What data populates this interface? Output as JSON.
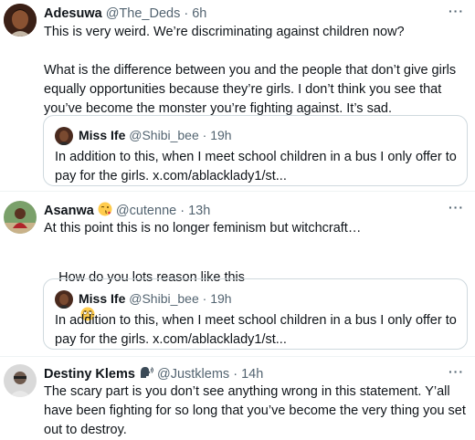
{
  "tweets": [
    {
      "name": "Adesuwa",
      "handle": "@The_Deds",
      "time": "6h",
      "text": "This is very weird. We’re discriminating against children now?\n\nWhat is the difference between you and the people that don’t give girls equally opportunities because they’re girls. I don’t think you see that you’ve become the monster you’re fighting against. It’s sad.",
      "quote": {
        "name": "Miss Ife",
        "handle": "@Shibi_bee",
        "time": "19h",
        "text": "In addition to this, when I meet school children in a bus I only offer to pay for the girls. x.com/ablacklady1/st..."
      }
    },
    {
      "name": "Asanwa",
      "name_emoji": "face-blowing-kiss",
      "handle": "@cutenne",
      "time": "13h",
      "line1": "At this point this is no longer feminism but witchcraft…",
      "line2": "How do you lots reason like this",
      "line2_emoji": "face-with-rolling-eyes",
      "quote": {
        "name": "Miss Ife",
        "handle": "@Shibi_bee",
        "time": "19h",
        "text": "In addition to this, when I meet school children in a bus I only offer to pay for the girls. x.com/ablacklady1/st..."
      }
    },
    {
      "name": "Destiny Klems",
      "name_emoji": "speaking-head",
      "handle": "@Justklems",
      "time": "14h",
      "text": "The scary part is you don’t see anything wrong in this statement. Y’all have been fighting for so long that you’ve become the very thing you set out to destroy."
    }
  ],
  "separator": "·",
  "more_label": "···",
  "colors": {
    "text": "#0f1419",
    "secondary": "#536471",
    "border": "#cfd9de",
    "divider": "#eff3f4"
  }
}
